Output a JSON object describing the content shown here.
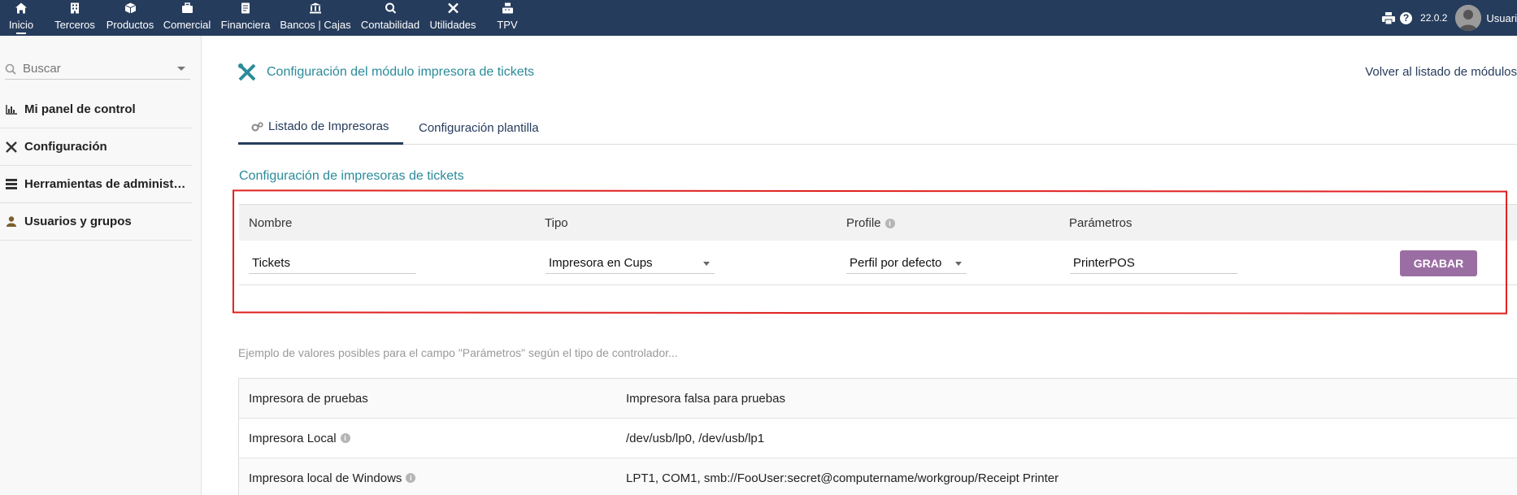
{
  "topbar": {
    "menu": [
      {
        "label": "Inicio",
        "icon": "home-icon"
      },
      {
        "label": "Terceros",
        "icon": "building-icon"
      },
      {
        "label": "Productos",
        "icon": "cube-icon"
      },
      {
        "label": "Comercial",
        "icon": "briefcase-icon"
      },
      {
        "label": "Financiera",
        "icon": "invoice-icon"
      },
      {
        "label": "Bancos | Cajas",
        "icon": "bank-icon"
      },
      {
        "label": "Contabilidad",
        "icon": "search-dollar-icon"
      },
      {
        "label": "Utilidades",
        "icon": "tools-icon"
      },
      {
        "label": "TPV",
        "icon": "cash-register-icon"
      }
    ],
    "version": "22.0.2",
    "user_label": "Usuari"
  },
  "sidebar": {
    "search_placeholder": "Buscar",
    "items": [
      {
        "label": "Mi panel de control",
        "icon": "chart-icon"
      },
      {
        "label": "Configuración",
        "icon": "tools-icon"
      },
      {
        "label": "Herramientas de administración",
        "icon": "server-icon"
      },
      {
        "label": "Usuarios y grupos",
        "icon": "user-icon"
      }
    ]
  },
  "main": {
    "title": "Configuración del módulo impresora de tickets",
    "back_link": "Volver al listado de módulos",
    "tabs": [
      {
        "label": "Listado de Impresoras",
        "active": true
      },
      {
        "label": "Configuración plantilla",
        "active": false
      }
    ],
    "section_title": "Configuración de impresoras de tickets",
    "printer_table": {
      "headers": {
        "name": "Nombre",
        "type": "Tipo",
        "profile": "Profile",
        "params": "Parámetros"
      },
      "row": {
        "name": "Tickets",
        "type": "Impresora en Cups",
        "profile": "Perfil por defecto",
        "params": "PrinterPOS",
        "save_label": "GRABAR"
      }
    },
    "example_text": "Ejemplo de valores posibles para el campo \"Parámetros\" según el tipo de controlador...",
    "examples": [
      {
        "name": "Impresora de pruebas",
        "value": "Impresora falsa para pruebas",
        "info": false
      },
      {
        "name": "Impresora Local",
        "value": "/dev/usb/lp0, /dev/usb/lp1",
        "info": true
      },
      {
        "name": "Impresora local de Windows",
        "value": "LPT1, COM1, smb://FooUser:secret@computername/workgroup/Receipt Printer",
        "info": true
      }
    ]
  },
  "colors": {
    "topbar": "#263c5c",
    "accent": "#2a8b9a",
    "save_button": "#9b6ea3",
    "highlight_box": "#e02020"
  }
}
